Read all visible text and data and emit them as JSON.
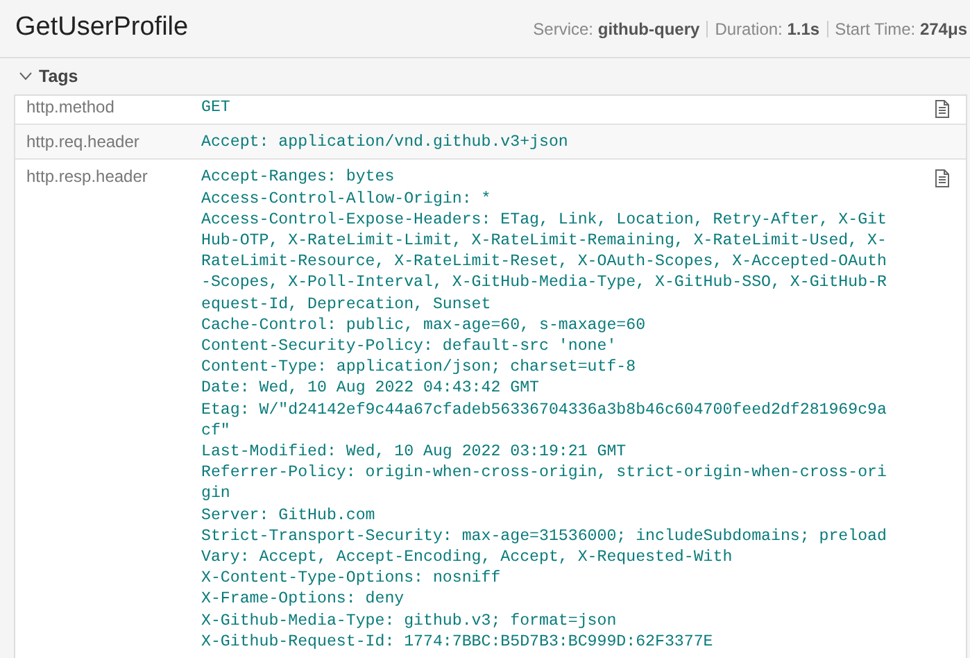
{
  "header": {
    "title": "GetUserProfile",
    "meta": [
      {
        "label": "Service:",
        "value": "github-query"
      },
      {
        "label": "Duration:",
        "value": "1.1s"
      },
      {
        "label": "Start Time:",
        "value": "274μs"
      }
    ]
  },
  "tags": {
    "title": "Tags",
    "expanded": true,
    "rows": [
      {
        "key": "http.method",
        "copy_icon": true,
        "lines": [
          "GET"
        ]
      },
      {
        "key": "http.req.header",
        "copy_icon": false,
        "lines": [
          "Accept: application/vnd.github.v3+json"
        ]
      },
      {
        "key": "http.resp.header",
        "copy_icon": true,
        "lines": [
          "Accept-Ranges: bytes",
          "Access-Control-Allow-Origin: *",
          "Access-Control-Expose-Headers: ETag, Link, Location, Retry-After, X-GitHub-OTP, X-RateLimit-Limit, X-RateLimit-Remaining, X-RateLimit-Used, X-RateLimit-Resource, X-RateLimit-Reset, X-OAuth-Scopes, X-Accepted-OAuth-Scopes, X-Poll-Interval, X-GitHub-Media-Type, X-GitHub-SSO, X-GitHub-Request-Id, Deprecation, Sunset",
          "Cache-Control: public, max-age=60, s-maxage=60",
          "Content-Security-Policy: default-src 'none'",
          "Content-Type: application/json; charset=utf-8",
          "Date: Wed, 10 Aug 2022 04:43:42 GMT",
          "Etag: W/\"d24142ef9c44a67cfadeb56336704336a3b8b46c604700feed2df281969c9acf\"",
          "Last-Modified: Wed, 10 Aug 2022 03:19:21 GMT",
          "Referrer-Policy: origin-when-cross-origin, strict-origin-when-cross-origin",
          "Server: GitHub.com",
          "Strict-Transport-Security: max-age=31536000; includeSubdomains; preload",
          "Vary: Accept, Accept-Encoding, Accept, X-Requested-With",
          "X-Content-Type-Options: nosniff",
          "X-Frame-Options: deny",
          "X-Github-Media-Type: github.v3; format=json",
          "X-Github-Request-Id: 1774:7BBC:B5D7B3:BC999D:62F3377E"
        ]
      }
    ]
  }
}
